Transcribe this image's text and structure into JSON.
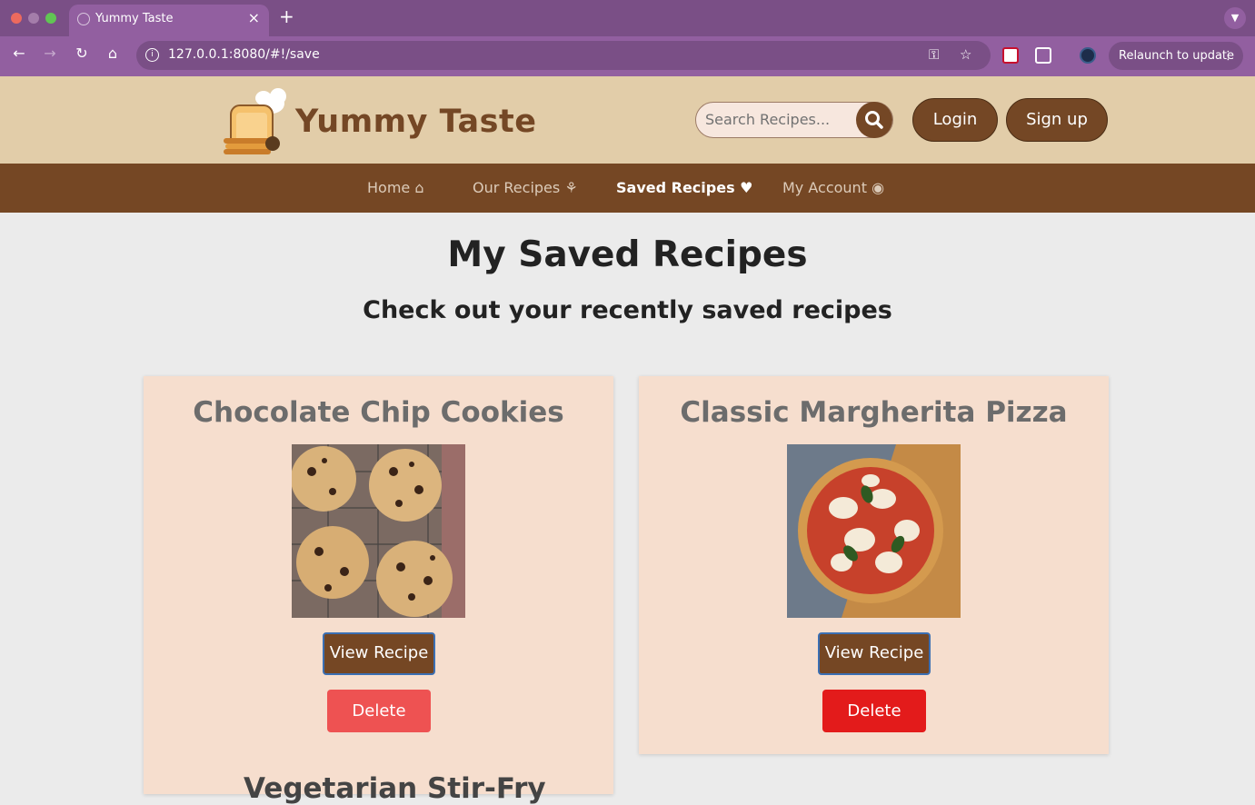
{
  "browser": {
    "tab_title": "Yummy Taste",
    "tab_close": "×",
    "new_tab": "+",
    "url": "127.0.0.1:8080/#!/save",
    "relaunch_label": "Relaunch to update"
  },
  "site": {
    "brand": "Yummy Taste",
    "search_placeholder": "Search Recipes...",
    "login_label": "Login",
    "signup_label": "Sign up"
  },
  "nav": {
    "items": [
      {
        "label": "Home",
        "icon": "home-icon"
      },
      {
        "label": "Our Recipes",
        "icon": "utensils-icon"
      },
      {
        "label": "Saved Recipes",
        "icon": "heart-icon",
        "active": true
      },
      {
        "label": "My Account",
        "icon": "user-circle-icon"
      }
    ]
  },
  "page": {
    "title": "My Saved Recipes",
    "subtitle": "Check out your recently saved recipes"
  },
  "recipes": [
    {
      "title": "Chocolate Chip Cookies",
      "view_label": "View Recipe",
      "delete_label": "Delete",
      "delete_color": "#ee5252"
    },
    {
      "title": "Classic Margherita Pizza",
      "view_label": "View Recipe",
      "delete_label": "Delete",
      "delete_color": "#e31b1b"
    },
    {
      "title": "Vegetarian Stir-Fry"
    }
  ],
  "colors": {
    "header_bg": "#e2cda9",
    "nav_bg": "#754724",
    "brand_brown": "#744725",
    "card_bg": "#f6dece",
    "browser_purple": "#925fa0"
  }
}
